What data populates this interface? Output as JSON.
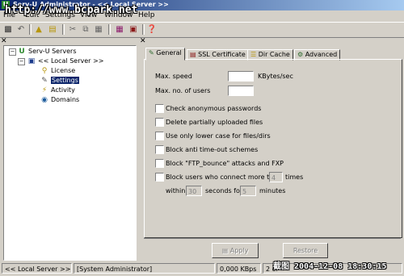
{
  "window": {
    "title": "Serv-U Administrator - << Local Server >>",
    "app_icon": "U"
  },
  "watermark": "http://www.bcpark.net",
  "menu": [
    "File",
    "Edit",
    "Settings",
    "View",
    "Window",
    "Help"
  ],
  "toolbar_icons": [
    "save-icon",
    "undo-icon",
    "folder-up-icon",
    "folder-icon",
    "cut-icon",
    "copy-icon",
    "paste-icon",
    "book-icon",
    "server-icon",
    "help-icon"
  ],
  "tree": {
    "root": "Serv-U Servers",
    "server": "<< Local Server >>",
    "items": [
      "License",
      "Settings",
      "Activity",
      "Domains"
    ],
    "selected": "Settings"
  },
  "tabs": [
    "General",
    "SSL Certificate",
    "Dir Cache",
    "Advanced"
  ],
  "general": {
    "max_speed_label": "Max. speed",
    "max_speed_value": "",
    "max_speed_unit": "KBytes/sec",
    "max_users_label": "Max. no. of users",
    "max_users_value": "",
    "options": [
      "Check anonymous passwords",
      "Delete partially uploaded files",
      "Use only lower case for files/dirs",
      "Block anti time-out schemes",
      "Block \"FTP_bounce\" attacks and FXP",
      "Block users who connect more than"
    ],
    "block_times_value": "4",
    "block_times_label": "times",
    "within_label": "within",
    "within_value": "30",
    "seconds_for_label": "seconds for",
    "minutes_value": "5",
    "minutes_label": "minutes"
  },
  "buttons": {
    "apply": "Apply",
    "restore": "Restore"
  },
  "status": {
    "server": "<< Local Server >>",
    "user": "[System Administrator]",
    "speed": "0,000 KBps",
    "count": "2 of"
  },
  "stamp": "截图 2004-12-08 18:30:15"
}
